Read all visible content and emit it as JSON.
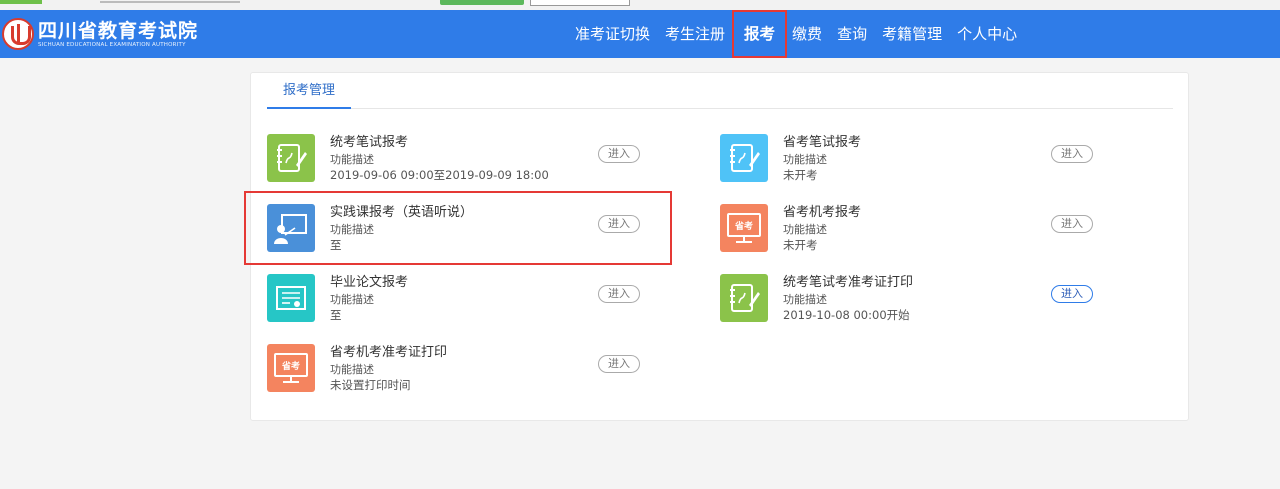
{
  "site": {
    "name_cn": "四川省教育考试院",
    "name_en": "SICHUAN EDUCATIONAL EXAMINATION AUTHORITY"
  },
  "nav": {
    "items": [
      {
        "label": "准考证切换"
      },
      {
        "label": "考生注册"
      },
      {
        "label": "报考",
        "active": true
      },
      {
        "label": "缴费"
      },
      {
        "label": "查询"
      },
      {
        "label": "考籍管理"
      },
      {
        "label": "个人中心"
      }
    ]
  },
  "panel": {
    "tab": "报考管理",
    "enter_label": "进入",
    "cards": [
      {
        "title": "统考笔试报考",
        "desc": "功能描述",
        "time": "2019-09-06 09:00至2019-09-09 18:00",
        "icon": "notebook-pen-icon"
      },
      {
        "title": "省考笔试报考",
        "desc": "功能描述",
        "time": "未开考",
        "icon": "notebook-pen-icon"
      },
      {
        "title": "实践课报考（英语听说）",
        "desc": "功能描述",
        "time": "至",
        "icon": "presenter-board-icon"
      },
      {
        "title": "省考机考报考",
        "desc": "功能描述",
        "time": "未开考",
        "icon": "computer-exam-icon",
        "icon_text": "省考"
      },
      {
        "title": "毕业论文报考",
        "desc": "功能描述",
        "time": "至",
        "icon": "certificate-icon"
      },
      {
        "title": "统考笔试考准考证打印",
        "desc": "功能描述",
        "time": "2019-10-08 00:00开始",
        "icon": "notebook-pen-icon"
      },
      {
        "title": "省考机考准考证打印",
        "desc": "功能描述",
        "time": "未设置打印时间",
        "icon": "computer-exam-icon",
        "icon_text": "省考"
      }
    ]
  },
  "colors": {
    "navbar": "#2f7ce8",
    "highlight": "#e53935",
    "green": "#8bc34a",
    "sky": "#4fc3f7",
    "blue": "#4a90d9",
    "orange": "#f4845f",
    "teal": "#26c6c6"
  }
}
